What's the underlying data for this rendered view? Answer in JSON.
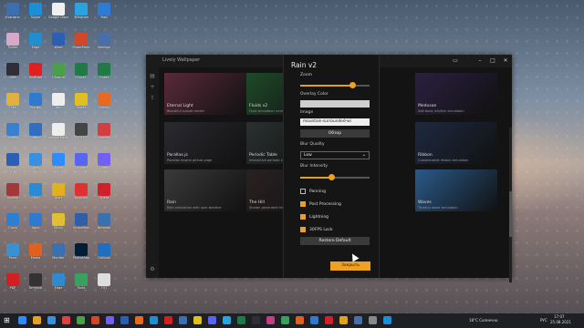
{
  "desktop_icons": [
    {
      "label": "Корзина",
      "icon": "recycle-bin-icon",
      "color": "#3b6fb0"
    },
    {
      "label": "Skype",
      "icon": "skype-icon",
      "color": "#1a8fd6"
    },
    {
      "label": "Google Docs",
      "icon": "docs-icon",
      "color": "#f0f0f0"
    },
    {
      "label": "Telegram",
      "icon": "telegram-icon",
      "color": "#2aa3e0"
    },
    {
      "label": "Mail",
      "icon": "mail-icon",
      "color": "#2e7bd6"
    },
    {
      "label": "Folder",
      "icon": "folder-icon",
      "color": "#d8a8c8"
    },
    {
      "label": "Edge",
      "icon": "edge-icon",
      "color": "#1f8fd0"
    },
    {
      "label": "Word",
      "icon": "word-icon",
      "color": "#2b5fb4"
    },
    {
      "label": "PowerPoint",
      "icon": "powerpoint-icon",
      "color": "#d24726"
    },
    {
      "label": "Settings",
      "icon": "gear-icon",
      "color": "#4a6fa8"
    },
    {
      "label": "OBS",
      "icon": "obs-icon",
      "color": "#302f38"
    },
    {
      "label": "YouTube",
      "icon": "youtube-icon",
      "color": "#e02020"
    },
    {
      "label": "Chrome",
      "icon": "chrome-icon",
      "color": "#4aa04a"
    },
    {
      "label": "Excel",
      "icon": "excel-icon",
      "color": "#1f7a45"
    },
    {
      "label": "Excel",
      "icon": "excel-icon",
      "color": "#1f7a45"
    },
    {
      "label": "Files",
      "icon": "folder-icon",
      "color": "#e0b040"
    },
    {
      "label": "Photos",
      "icon": "photo-icon",
      "color": "#2f7ad0"
    },
    {
      "label": "Abc",
      "icon": "font-icon",
      "color": "#eeeeee"
    },
    {
      "label": "Power",
      "icon": "power-icon",
      "color": "#e0c020"
    },
    {
      "label": "Firefox",
      "icon": "firefox-icon",
      "color": "#e86a20"
    },
    {
      "label": "Gallery",
      "icon": "gallery-icon",
      "color": "#3a80d0"
    },
    {
      "label": "Store",
      "icon": "store-icon",
      "color": "#2f6fc0"
    },
    {
      "label": "Google Earth",
      "icon": "globe-icon",
      "color": "#eeeeee"
    },
    {
      "label": "TXT",
      "icon": "text-file-icon",
      "color": "#444444"
    },
    {
      "label": "Mobile",
      "icon": "phone-icon",
      "color": "#d04040"
    },
    {
      "label": "Word",
      "icon": "word-icon",
      "color": "#2b5fb4"
    },
    {
      "label": "Apps",
      "icon": "apps-icon",
      "color": "#3a90e0"
    },
    {
      "label": "Zoom",
      "icon": "zoom-icon",
      "color": "#2d8cff"
    },
    {
      "label": "Discord",
      "icon": "discord-icon",
      "color": "#5865f2"
    },
    {
      "label": "Viber",
      "icon": "viber-icon",
      "color": "#7360f2"
    },
    {
      "label": "Access",
      "icon": "access-icon",
      "color": "#a4373a"
    },
    {
      "label": "Grid",
      "icon": "grid-icon",
      "color": "#2b8ad0"
    },
    {
      "label": "Alert",
      "icon": "alert-icon",
      "color": "#e0b020"
    },
    {
      "label": "psiphon",
      "icon": "psiphon-icon",
      "color": "#e03030"
    },
    {
      "label": "Opera",
      "icon": "opera-icon",
      "color": "#d0202a"
    },
    {
      "label": "Clock",
      "icon": "clock-icon",
      "color": "#2d80d0"
    },
    {
      "label": "Apps",
      "icon": "apps-icon",
      "color": "#2f7ad0"
    },
    {
      "label": "Sticky",
      "icon": "note-icon",
      "color": "#e0c030"
    },
    {
      "label": "VirtualBox",
      "icon": "virtualbox-icon",
      "color": "#2f5fa8"
    },
    {
      "label": "Network",
      "icon": "network-icon",
      "color": "#3a6fb0"
    },
    {
      "label": "Paint",
      "icon": "paint-icon",
      "color": "#3a90d0"
    },
    {
      "label": "Media",
      "icon": "media-icon",
      "color": "#e06020"
    },
    {
      "label": "Monitor",
      "icon": "monitor-icon",
      "color": "#3a70b0"
    },
    {
      "label": "Photoshop",
      "icon": "photoshop-icon",
      "color": "#001e36"
    },
    {
      "label": "Outlook",
      "icon": "outlook-icon",
      "color": "#1f6fc0"
    },
    {
      "label": "PDF",
      "icon": "pdf-icon",
      "color": "#d02020"
    },
    {
      "label": "Terminal",
      "icon": "terminal-icon",
      "color": "#333333"
    },
    {
      "label": "Edge",
      "icon": "edge-icon",
      "color": "#2f8ad0"
    },
    {
      "label": "Tools",
      "icon": "tools-icon",
      "color": "#3aa060"
    },
    {
      "label": "TXT",
      "icon": "text-file-icon",
      "color": "#dddddd"
    }
  ],
  "app": {
    "title": "Lively Wallpaper",
    "rail_icons": [
      "library-icon",
      "add-icon",
      "share-icon",
      "settings-icon"
    ],
    "tiles": [
      {
        "title": "Eternal Light",
        "desc": "Beautiful sunset render",
        "color": "#5a2a3a"
      },
      {
        "title": "Fluids v2",
        "desc": "Fluid simulation running",
        "color": "#1f4a2a"
      },
      {
        "title": "Medusae",
        "desc": "Soft body jellyfish simulation",
        "color": "#2a2040"
      },
      {
        "title": "Parallax.js",
        "desc": "Parallax engine github page",
        "color": "#2a2a30"
      },
      {
        "title": "Periodic Table",
        "desc": "Interactive periodic table",
        "color": "#2a3030"
      },
      {
        "title": "Ribbon",
        "desc": "Customizable ribbon simulation",
        "color": "#1e2a40"
      },
      {
        "title": "Rain",
        "desc": "Rain simulation with user weather",
        "color": "#3a3a3a"
      },
      {
        "title": "The Hill",
        "desc": "Shader generated hill",
        "color": "#2a2222"
      },
      {
        "title": "Waves",
        "desc": "Three.js wave simulation",
        "color": "#2a5a8a"
      }
    ]
  },
  "panel": {
    "title": "Rain v2",
    "zoom_label": "Zoom",
    "zoom_value": 0.75,
    "overlay_color_label": "Overlay Color",
    "overlay_color": "#cfcfcf",
    "image_label": "Image",
    "image_value": "mountain-surrounded-wi",
    "browse_label": "Обзор",
    "blur_quality_label": "Blur Quality",
    "blur_quality_value": "Low",
    "blur_intensity_label": "Blur Intensity",
    "blur_intensity_value": 0.45,
    "checkboxes": [
      {
        "label": "Panning",
        "checked": false
      },
      {
        "label": "Post Processing",
        "checked": true
      },
      {
        "label": "Lightning",
        "checked": true
      },
      {
        "label": "30FPS Lock",
        "checked": true
      }
    ],
    "restore_label": "Restore Default",
    "apply_label": "Закрыть",
    "accent": "#f0a020"
  },
  "taskbar": {
    "weather": "18°C Солнечно",
    "lang": "РУС",
    "time": "17:07",
    "date": "25.08.2021"
  }
}
